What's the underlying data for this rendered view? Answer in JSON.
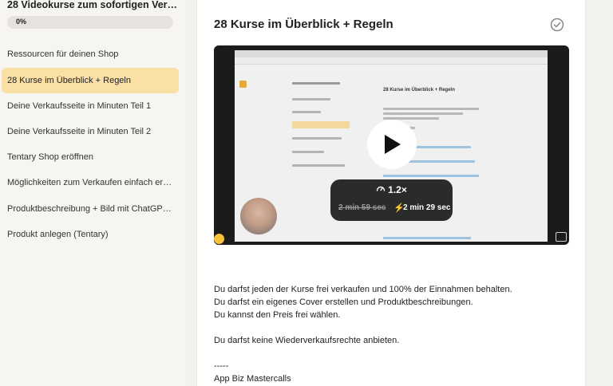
{
  "sidebar": {
    "course_title": "28 Videokurse zum sofortigen Verkauf ...",
    "progress_label": "0%",
    "progress": 0,
    "items": [
      {
        "label": "Ressourcen für deinen Shop"
      },
      {
        "label": "28 Kurse im Überblick + Regeln",
        "active": true
      },
      {
        "label": "Deine Verkaufsseite in Minuten Teil 1"
      },
      {
        "label": "Deine Verkaufsseite in Minuten Teil 2"
      },
      {
        "label": "Tentary Shop eröffnen"
      },
      {
        "label": "Möglichkeiten zum Verkaufen einfach erkl..."
      },
      {
        "label": "Produktbeschreibung + Bild mit ChatGPT ..."
      },
      {
        "label": "Produkt anlegen (Tentary)"
      }
    ]
  },
  "lesson": {
    "title": "28 Kurse im Überblick + Regeln",
    "complete_icon": "check-circle-icon"
  },
  "video": {
    "speed": "1.2×",
    "old_duration": "2 min 59 sec",
    "new_duration": "2 min 29 sec",
    "play_icon": "play-icon",
    "bolt_glyph": "⚡",
    "screen_title": "28 Kurse im Überblick + Regeln"
  },
  "description": {
    "lines": [
      "Du darfst jeden der Kurse frei verkaufen und 100% der Einnahmen behalten.",
      "Du darfst ein eigenes Cover erstellen und Produktbeschreibungen.",
      "Du kannst den Preis frei wählen.",
      "Du darfst keine Wiederverkaufsrechte anbieten.",
      "-----",
      "App Biz Mastercalls"
    ]
  },
  "colors": {
    "active_lesson": "#fbe0a6",
    "sidebar_bg": "#f7f5f2",
    "main_bg": "#ffffff"
  }
}
